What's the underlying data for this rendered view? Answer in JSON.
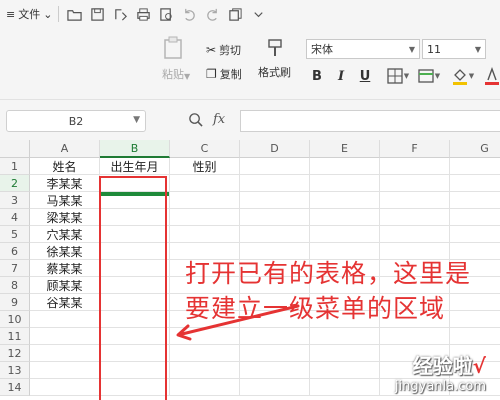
{
  "topbar": {
    "file_menu": "文件"
  },
  "ribbon": {
    "paste": "粘贴",
    "cut": "剪切",
    "copy": "复制",
    "format_painter": "格式刷",
    "font_name": "宋体",
    "font_size": "11",
    "bold": "B",
    "italic": "I",
    "underline": "U"
  },
  "formula_bar": {
    "cell_ref": "B2",
    "fx": "fx",
    "formula": ""
  },
  "columns": [
    "A",
    "B",
    "C",
    "D",
    "E",
    "F",
    "G"
  ],
  "active_column": "B",
  "rows": [
    "1",
    "2",
    "3",
    "4",
    "5",
    "6",
    "7",
    "8",
    "9",
    "10",
    "11",
    "12",
    "13",
    "14"
  ],
  "active_row": "2",
  "cells": {
    "A1": "姓名",
    "B1": "出生年月",
    "C1": "性别",
    "A2": "李某某",
    "A3": "马某某",
    "A4": "梁某某",
    "A5": "穴某某",
    "A6": "徐某某",
    "A7": "蔡某某",
    "A8": "顾某某",
    "A9": "谷某某"
  },
  "annotation": {
    "line1": "打开已有的表格，这里是",
    "line2": "要建立一级菜单的区域",
    "color": "#e53333"
  },
  "watermark": {
    "title": "经验啦",
    "check": "√",
    "url": "jingyanla.com"
  },
  "colors": {
    "accent": "#1e7b34",
    "highlight": "#e53333"
  }
}
